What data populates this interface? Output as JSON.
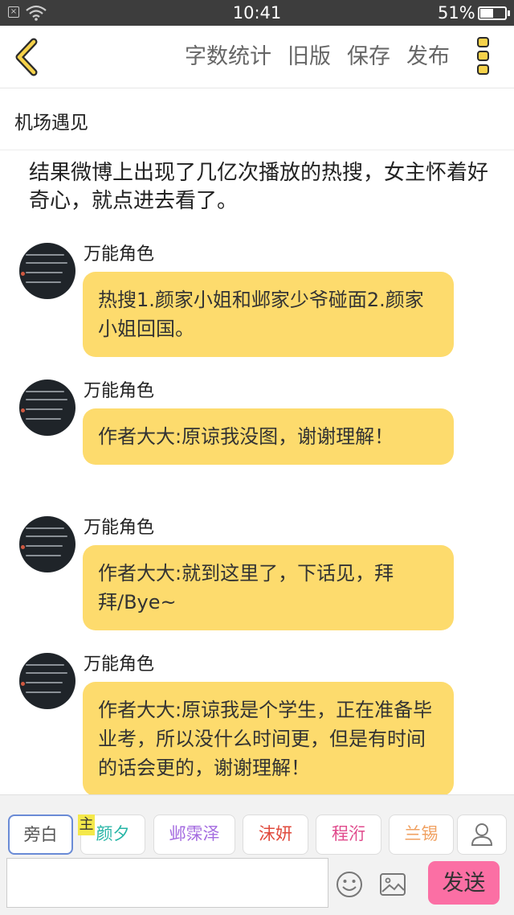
{
  "status_bar": {
    "time": "10:41",
    "battery": "51%",
    "battery_fraction": 0.51
  },
  "toolbar": {
    "actions": [
      "字数统计",
      "旧版",
      "保存",
      "发布"
    ],
    "back_icon": "chevron-left-icon",
    "more_icon": "more-vertical-icon",
    "accent_color": "#f6d24a"
  },
  "story": {
    "title": "机场遇见",
    "narration": "结果微博上出现了几亿次播放的热搜，女主怀着好奇心，就点进去看了。"
  },
  "messages": [
    {
      "role": "万能角色",
      "text": "热搜1.颜家小姐和邺家少爷碰面2.颜家小姐回国。"
    },
    {
      "role": "万能角色",
      "text": "作者大大:原谅我没图，谢谢理解！"
    },
    {
      "role": "万能角色",
      "text": "作者大大:就到这里了，下话见，拜拜/Bye~"
    },
    {
      "role": "万能角色",
      "text": "作者大大:原谅我是个学生，正在准备毕业考，所以没什么时间更，但是有时间的话会更的，谢谢理解！"
    }
  ],
  "bubble_color": "#fddb6d",
  "bottom": {
    "main_tag": "主",
    "roles": [
      {
        "label": "旁白",
        "color": "#555555"
      },
      {
        "label": "颜夕",
        "color": "#26b5a6"
      },
      {
        "label": "邺霂泽",
        "color": "#a46be0"
      },
      {
        "label": "沫妍",
        "color": "#e04a3c"
      },
      {
        "label": "程洐",
        "color": "#e04a8c"
      },
      {
        "label": "兰锡",
        "color": "#f0a060"
      }
    ],
    "input_value": "",
    "send_label": "发送",
    "send_color": "#fb6fa4"
  }
}
